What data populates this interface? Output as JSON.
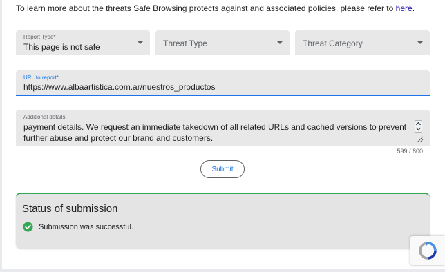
{
  "intro": {
    "text": "To learn more about the threats Safe Browsing protects against and associated policies, please refer to ",
    "link": "here",
    "suffix": "."
  },
  "form": {
    "report_type": {
      "label": "Report Type*",
      "value": "This page is not safe"
    },
    "threat_type": {
      "placeholder": "Threat Type"
    },
    "threat_category": {
      "placeholder": "Threat Category"
    },
    "url": {
      "label": "URL to report*",
      "value": "https://www.albaartistica.com.ar/nuestros_productos"
    },
    "details": {
      "label": "Additional details",
      "value": "payment details. We request an immediate takedown of all related URLs and cached versions to prevent further abuse and protect our brand and customers.",
      "counter": "599 / 800"
    },
    "submit_label": "Submit"
  },
  "status": {
    "title": "Status of submission",
    "message": "Submission was successful."
  },
  "icons": {
    "success": "check-circle-icon",
    "dropdown": "chevron-down-icon",
    "recaptcha": "recaptcha-icon"
  },
  "colors": {
    "accent": "#1a73e8",
    "success": "#34a853",
    "field_bg": "#e8e8e8"
  }
}
